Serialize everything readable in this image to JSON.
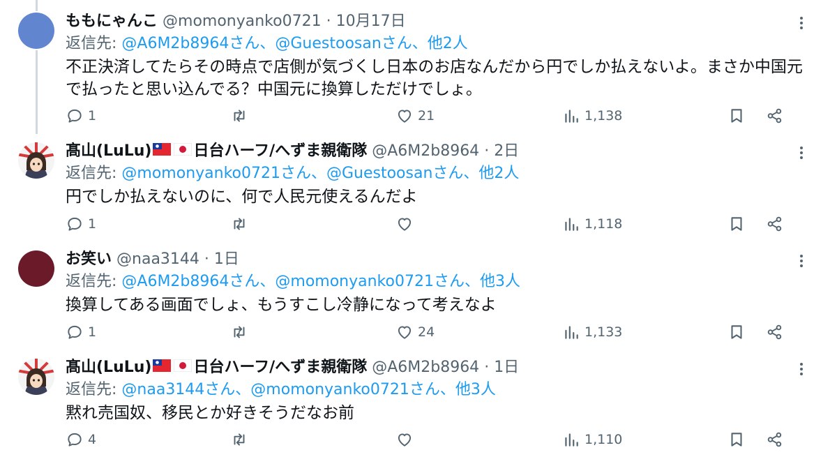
{
  "tweets": [
    {
      "display_name": "ももにゃんこ",
      "handle": "@momonyanko0721",
      "sep": "·",
      "time": "10月17日",
      "reply_prefix": "返信先: ",
      "reply_links": "@A6M2b8964さん、@Guestoosanさん、他2人",
      "body": "不正決済してたらその時点で店側が気づくし日本のお店なんだから円でしか払えないよ。まさか中国元で払ったと思い込んでる？中国元に換算しただけでしょ。",
      "replies": "1",
      "retweets": "",
      "likes": "21",
      "views": "1,138",
      "avatar": "blue-circle"
    },
    {
      "display_name": "髙山(LuLu)",
      "name_suffix": "日台ハーフ/へずま親衛隊",
      "handle": "@A6M2b8964",
      "sep": "·",
      "time": "2日",
      "reply_prefix": "返信先: ",
      "reply_links": "@momonyanko0721さん、@Guestoosanさん、他2人",
      "body": "円でしか払えないのに、何で人民元使えるんだよ",
      "replies": "1",
      "retweets": "",
      "likes": "",
      "views": "1,118",
      "avatar": "anime-rising-sun"
    },
    {
      "display_name": "お笑い",
      "handle": "@naa3144",
      "sep": "·",
      "time": "1日",
      "reply_prefix": "返信先: ",
      "reply_links": "@A6M2b8964さん、@momonyanko0721さん、他3人",
      "body": "換算してある画面でしょ、もうすこし冷静になって考えなよ",
      "replies": "1",
      "retweets": "",
      "likes": "24",
      "views": "1,133",
      "avatar": "maroon-circle"
    },
    {
      "display_name": "髙山(LuLu)",
      "name_suffix": "日台ハーフ/へずま親衛隊",
      "handle": "@A6M2b8964",
      "sep": "·",
      "time": "1日",
      "reply_prefix": "返信先: ",
      "reply_links": "@naa3144さん、@momonyanko0721さん、他3人",
      "body": "黙れ売国奴、移民とか好きそうだなお前",
      "replies": "4",
      "retweets": "",
      "likes": "",
      "views": "1,110",
      "avatar": "anime-rising-sun"
    }
  ],
  "icons": {
    "reply": "speech-bubble-icon",
    "retweet": "retweet-arrows-icon",
    "like": "heart-icon",
    "views": "bar-chart-icon",
    "bookmark": "bookmark-icon",
    "share": "share-icon",
    "more": "more-dots-icon"
  },
  "colors": {
    "text": "#0f1419",
    "muted": "#536471",
    "link": "#1d9bf0",
    "thread_line": "#cfd9de"
  }
}
